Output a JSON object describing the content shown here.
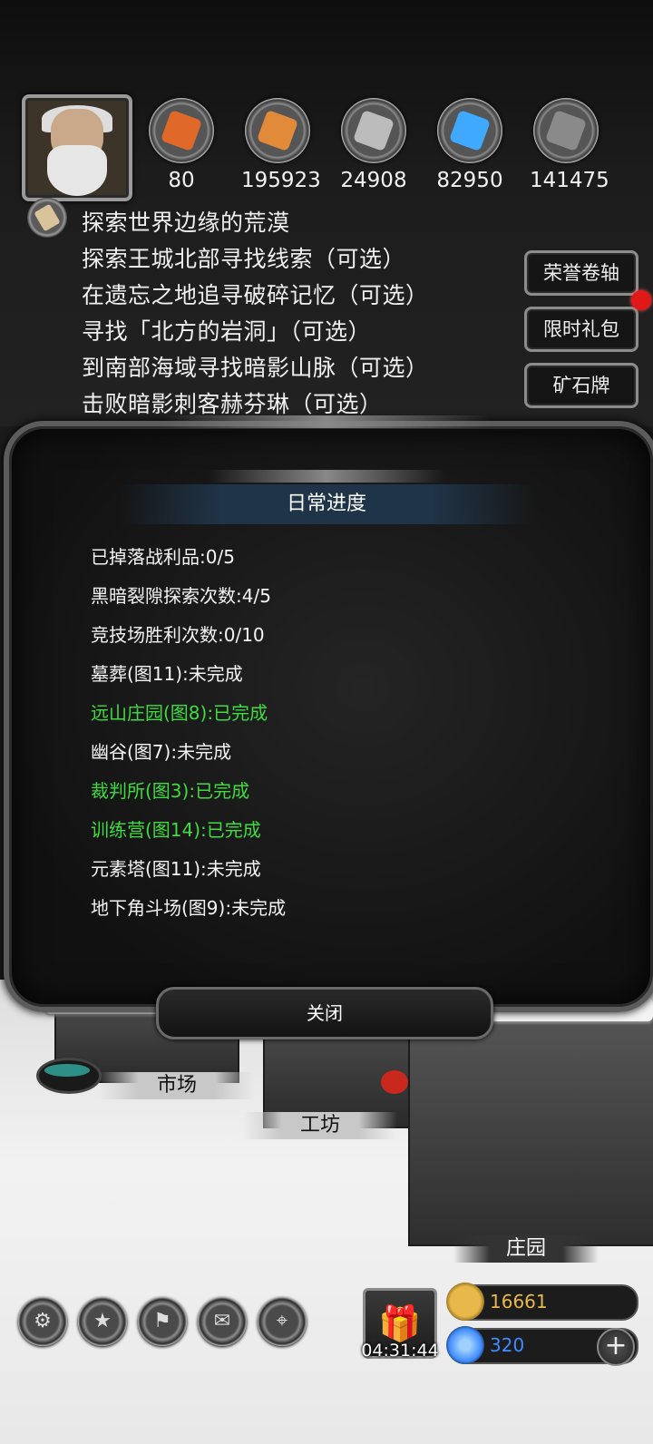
{
  "resources": [
    {
      "icon": "meat-icon",
      "value": "80",
      "color": "#e0692a"
    },
    {
      "icon": "wood-icon",
      "value": "195923",
      "color": "#e08a3a"
    },
    {
      "icon": "iron-icon",
      "value": "24908",
      "color": "#bcbcbc"
    },
    {
      "icon": "crystal-icon",
      "value": "82950",
      "color": "#3fa8ff"
    },
    {
      "icon": "stone-icon",
      "value": "141475",
      "color": "#8a8a8a"
    }
  ],
  "quests": [
    "探索世界边缘的荒漠",
    "探索王城北部寻找线索（可选）",
    "在遗忘之地追寻破碎记忆（可选）",
    "寻找「北方的岩洞」（可选）",
    "到南部海域寻找暗影山脉（可选）",
    "击败暗影刺客赫芬琳（可选）"
  ],
  "side_buttons": [
    "荣誉卷轴",
    "限时礼包",
    "矿石牌"
  ],
  "panel": {
    "title": "日常进度",
    "items": [
      {
        "text": "已掉落战利品:0/5",
        "status": "todo"
      },
      {
        "text": "黑暗裂隙探索次数:4/5",
        "status": "todo"
      },
      {
        "text": "竞技场胜利次数:0/10",
        "status": "todo"
      },
      {
        "text": "墓葬(图11):未完成",
        "status": "todo"
      },
      {
        "text": "远山庄园(图8):已完成",
        "status": "done"
      },
      {
        "text": "幽谷(图7):未完成",
        "status": "todo"
      },
      {
        "text": "裁判所(图3):已完成",
        "status": "done"
      },
      {
        "text": "训练营(图14):已完成",
        "status": "done"
      },
      {
        "text": "元素塔(图11):未完成",
        "status": "todo"
      },
      {
        "text": "地下角斗场(图9):未完成",
        "status": "todo"
      }
    ],
    "close_label": "关闭"
  },
  "locations": {
    "market": "市场",
    "workshop": "工坊",
    "manor": "庄园"
  },
  "timer": "04:31:44",
  "currency": {
    "gold": "16661",
    "gems": "320",
    "gold_color": "#e8b84a",
    "gem_color": "#3f8cff"
  },
  "toolbar": [
    "settings-icon",
    "star-icon",
    "guild-icon",
    "mail-icon",
    "map-icon"
  ]
}
